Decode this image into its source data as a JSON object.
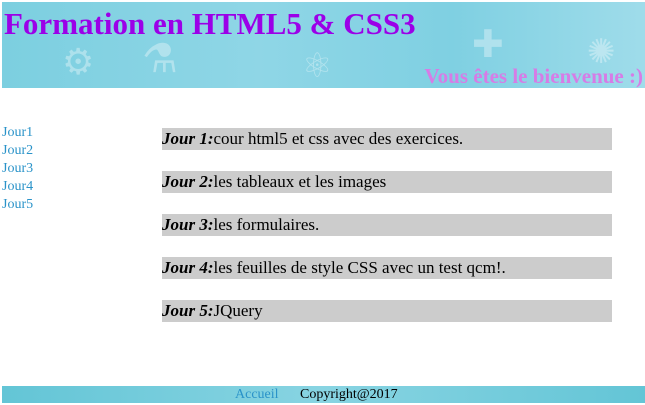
{
  "header": {
    "title": "Formation en HTML5 & CSS3",
    "welcome": "Vous êtes le bienvenue :)"
  },
  "sidenav": {
    "items": [
      {
        "label": "Jour1"
      },
      {
        "label": "Jour2"
      },
      {
        "label": "Jour3"
      },
      {
        "label": "Jour4"
      },
      {
        "label": "Jour5"
      }
    ]
  },
  "days": [
    {
      "label": "Jour 1:",
      "text": "cour html5 et css avec des exercices."
    },
    {
      "label": "Jour 2:",
      "text": "les tableaux et les images"
    },
    {
      "label": "Jour 3:",
      "text": "les formulaires."
    },
    {
      "label": "Jour 4:",
      "text": "les feuilles de style CSS avec un test qcm!."
    },
    {
      "label": "Jour 5:",
      "text": "JQuery"
    }
  ],
  "footer": {
    "home_link": "Accueil",
    "copyright": "Copyright@2017"
  },
  "colors": {
    "title": "#9b00e8",
    "welcome": "#d67ce6",
    "link": "#2a93c9",
    "banner": "#8fd6e6",
    "row_background": "#cccccc"
  }
}
